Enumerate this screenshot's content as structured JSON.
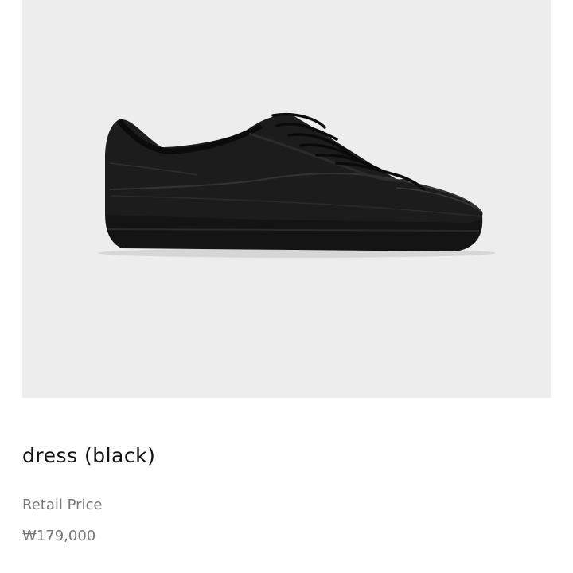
{
  "product": {
    "name": "dress (black)",
    "retail_price_label": "Retail Price",
    "retail_price": "₩179,000",
    "price_struck_through": true
  },
  "image": {
    "subject": "black leather low-top lace-up sneaker, side view",
    "background_color": "#ededed"
  }
}
